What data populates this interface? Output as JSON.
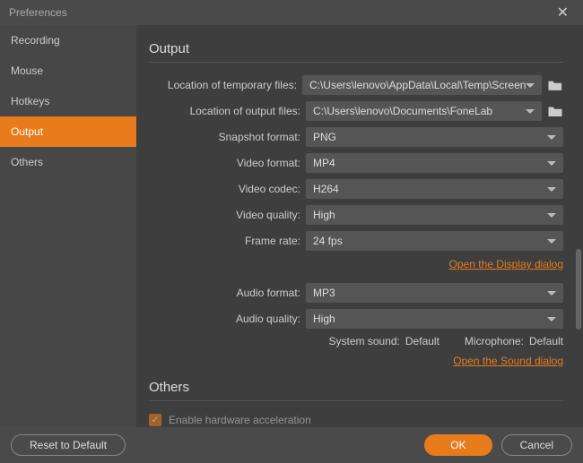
{
  "title": "Preferences",
  "sidebar": {
    "items": [
      {
        "label": "Recording"
      },
      {
        "label": "Mouse"
      },
      {
        "label": "Hotkeys"
      },
      {
        "label": "Output"
      },
      {
        "label": "Others"
      }
    ],
    "activeIndex": 3
  },
  "sections": {
    "output": {
      "title": "Output",
      "tempFilesLabel": "Location of temporary files:",
      "tempFilesValue": "C:\\Users\\lenovo\\AppData\\Local\\Temp\\Screen",
      "outputFilesLabel": "Location of output files:",
      "outputFilesValue": "C:\\Users\\lenovo\\Documents\\FoneLab",
      "snapshotFormatLabel": "Snapshot format:",
      "snapshotFormatValue": "PNG",
      "videoFormatLabel": "Video format:",
      "videoFormatValue": "MP4",
      "videoCodecLabel": "Video codec:",
      "videoCodecValue": "H264",
      "videoQualityLabel": "Video quality:",
      "videoQualityValue": "High",
      "frameRateLabel": "Frame rate:",
      "frameRateValue": "24 fps",
      "displayLink": "Open the Display dialog",
      "audioFormatLabel": "Audio format:",
      "audioFormatValue": "MP3",
      "audioQualityLabel": "Audio quality:",
      "audioQualityValue": "High",
      "systemSoundLabel": "System sound:",
      "systemSoundValue": "Default",
      "microphoneLabel": "Microphone:",
      "microphoneValue": "Default",
      "soundLink": "Open the Sound dialog"
    },
    "others": {
      "title": "Others",
      "hwAccelLabel": "Enable hardware acceleration"
    }
  },
  "footer": {
    "reset": "Reset to Default",
    "ok": "OK",
    "cancel": "Cancel"
  }
}
